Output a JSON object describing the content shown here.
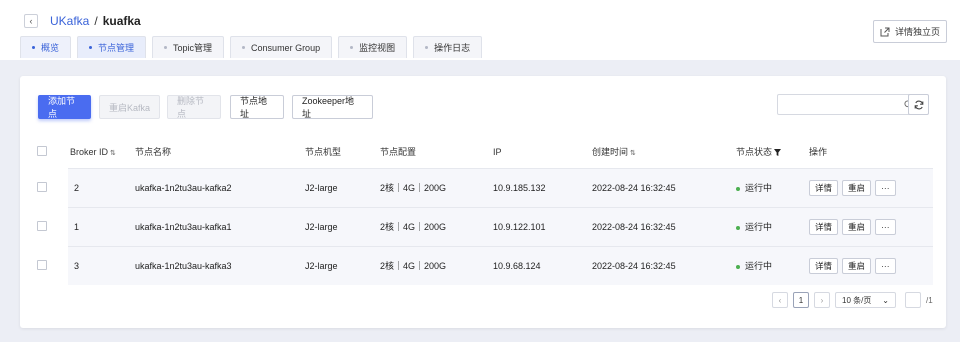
{
  "breadcrumb": {
    "root": "UKafka",
    "separator": "/",
    "current": "kuafka"
  },
  "header": {
    "detail_button": "详情独立页"
  },
  "tabs": [
    {
      "label": "概览"
    },
    {
      "label": "节点管理"
    },
    {
      "label": "Topic管理"
    },
    {
      "label": "Consumer Group"
    },
    {
      "label": "监控视图"
    },
    {
      "label": "操作日志"
    }
  ],
  "toolbar": {
    "add": "添加节点",
    "restart_kafka": "重启Kafka",
    "delete": "删除节点",
    "node_address": "节点地址",
    "zookeeper_address": "Zookeeper地址",
    "search_placeholder": ""
  },
  "table": {
    "headers": {
      "broker_id": "Broker ID",
      "name": "节点名称",
      "model": "节点机型",
      "config": "节点配置",
      "ip": "IP",
      "created": "创建时间",
      "status": "节点状态",
      "actions": "操作"
    },
    "rows": [
      {
        "broker_id": "2",
        "name": "ukafka-1n2tu3au-kafka2",
        "model": "J2-large",
        "config": "2核｜4G｜200G",
        "ip": "10.9.185.132",
        "created": "2022-08-24 16:32:45",
        "status": "运行中"
      },
      {
        "broker_id": "1",
        "name": "ukafka-1n2tu3au-kafka1",
        "model": "J2-large",
        "config": "2核｜4G｜200G",
        "ip": "10.9.122.101",
        "created": "2022-08-24 16:32:45",
        "status": "运行中"
      },
      {
        "broker_id": "3",
        "name": "ukafka-1n2tu3au-kafka3",
        "model": "J2-large",
        "config": "2核｜4G｜200G",
        "ip": "10.9.68.124",
        "created": "2022-08-24 16:32:45",
        "status": "运行中"
      }
    ],
    "row_actions": {
      "detail": "详情",
      "restart": "重启",
      "more": "···"
    }
  },
  "pagination": {
    "prev": "‹",
    "current_page": "1",
    "next": "›",
    "page_size": "10 条/页",
    "total_pages": "/1"
  },
  "colors": {
    "primary": "#4a6cf0",
    "link": "#3a63d9",
    "status_running": "#4caf50"
  }
}
